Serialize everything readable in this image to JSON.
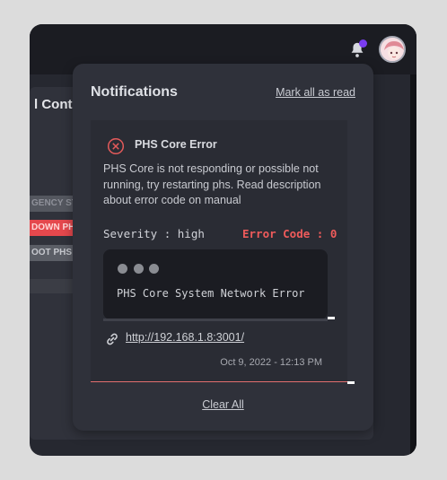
{
  "background": {
    "section_title": "l Contro",
    "buttons": {
      "emergency": "GENCY STO",
      "shutdown": "DOWN PH",
      "reboot": "OOT PHS"
    }
  },
  "header": {
    "bell_icon": "bell-icon",
    "avatar_icon": "avatar-icon"
  },
  "notifications": {
    "title": "Notifications",
    "mark_all_label": "Mark all as read",
    "clear_all_label": "Clear All",
    "items": [
      {
        "icon": "error-circle-icon",
        "title": "PHS Core Error",
        "description": "PHS Core is not responding or possible not running, try restarting phs. Read description about error code on manual",
        "severity": "Severity : high",
        "error_code": "Error Code : 0",
        "terminal_text": "PHS Core System Network Error",
        "link": "http://192.168.1.8:3001/",
        "timestamp": "Oct 9, 2022 - 12:13 PM"
      }
    ]
  },
  "colors": {
    "accent_error": "#ef5b5b",
    "badge": "#7a3cf0",
    "panel": "#2f313a"
  }
}
